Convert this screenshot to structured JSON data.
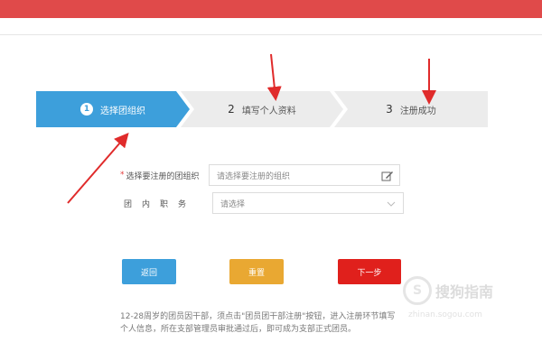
{
  "steps": [
    {
      "number": "1",
      "label": "选择团组织",
      "active": true
    },
    {
      "number": "2",
      "label": "填写个人资料",
      "active": false
    },
    {
      "number": "3",
      "label": "注册成功",
      "active": false
    }
  ],
  "form": {
    "org_label": "选择要注册的团组织",
    "org_placeholder": "请选择要注册的组织",
    "position_label": "团内职务",
    "position_value": "请选择"
  },
  "buttons": {
    "back": "返回",
    "reset": "重置",
    "next": "下一步"
  },
  "info_text": "12-28周岁的团员因干部，须点击\"团员团干部注册\"按钮，进入注册环节填写个人信息，所在支部管理员审批通过后，即可成为支部正式团员。",
  "watermark": {
    "text": "搜狗指南",
    "url": "zhinan.sogou.com"
  },
  "colors": {
    "active_step": "#3d9fdb",
    "inactive_step": "#ececec",
    "btn_back": "#3d9fdb",
    "btn_reset": "#e9a832",
    "btn_next": "#e0201c",
    "arrow": "#e02b2b"
  },
  "icons": [
    "edit-icon",
    "chevron-down-icon",
    "sogou-logo-icon"
  ]
}
